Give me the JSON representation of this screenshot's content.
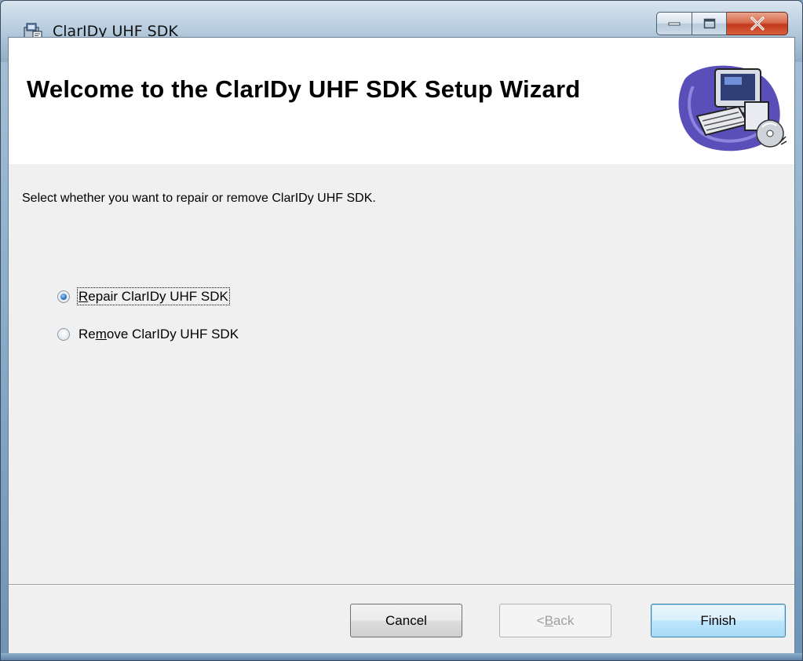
{
  "window": {
    "title": "ClarIDy UHF SDK",
    "minimize_icon": "minimize-icon",
    "maximize_icon": "maximize-icon",
    "close_icon": "close-icon"
  },
  "banner": {
    "title": "Welcome to the ClarIDy UHF SDK Setup Wizard",
    "art_icon": "computer-setup-icon"
  },
  "body": {
    "prompt": "Select whether you want to repair or remove ClarIDy UHF SDK."
  },
  "options": {
    "repair": {
      "pre": "",
      "accel": "R",
      "post": "epair ClarIDy UHF SDK",
      "selected": true
    },
    "remove": {
      "pre": "Re",
      "accel": "m",
      "post": "ove ClarIDy UHF SDK",
      "selected": false
    }
  },
  "buttons": {
    "cancel": {
      "label": "Cancel"
    },
    "back": {
      "pre": "< ",
      "accel": "B",
      "post": "ack"
    },
    "finish": {
      "label": "Finish"
    }
  },
  "colors": {
    "accent": "#3c7fb1",
    "close_button": "#c2391a",
    "radio_selected": "#2c78c8"
  }
}
